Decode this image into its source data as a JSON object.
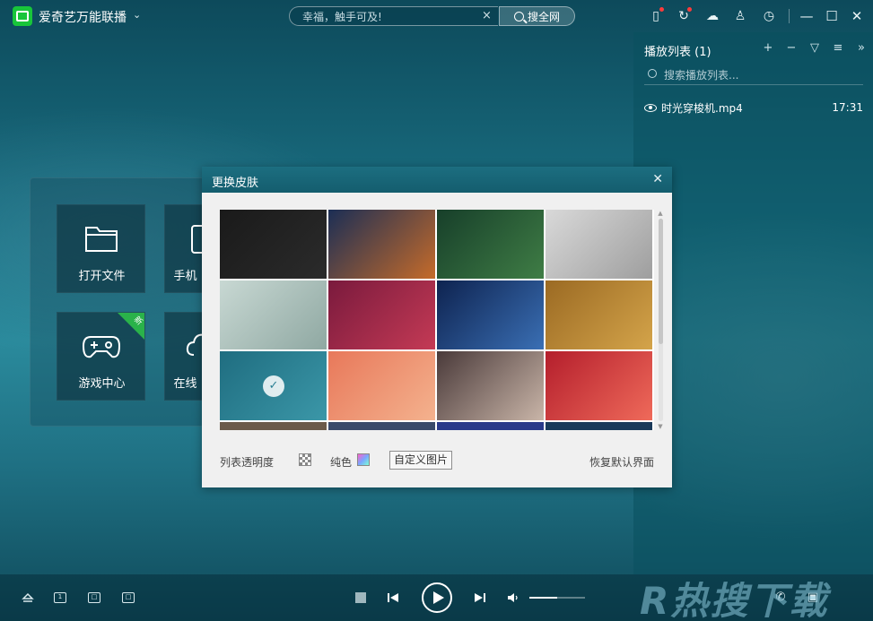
{
  "titlebar": {
    "app_title": "爱奇艺万能联播",
    "search_placeholder": "幸福，触手可及!",
    "search_button": "搜全网"
  },
  "playlist": {
    "title": "播放列表 (1)",
    "search_placeholder": "搜索播放列表...",
    "items": [
      {
        "name": "时光穿梭机.mp4",
        "duration": "17:31"
      }
    ]
  },
  "home": {
    "tiles": [
      {
        "label": "打开文件",
        "icon": "folder-icon"
      },
      {
        "label": "手机",
        "icon": "phone-icon"
      },
      {
        "label": "游戏中心",
        "icon": "gamepad-icon",
        "badge": "新"
      },
      {
        "label": "在线",
        "icon": "cloud-icon"
      }
    ]
  },
  "skin_dialog": {
    "title": "更换皮肤",
    "selected_index": 8,
    "skins": [
      {
        "name": "skin-iqiyi-logo",
        "colors": [
          "#1a1a1a",
          "#2b2b2b"
        ]
      },
      {
        "name": "skin-cartoon-rabbit",
        "colors": [
          "#1b2e55",
          "#c56b2a"
        ]
      },
      {
        "name": "skin-lotus",
        "colors": [
          "#173f2a",
          "#3f7d45"
        ]
      },
      {
        "name": "skin-gray-geometry",
        "colors": [
          "#d9d9d9",
          "#9e9e9e"
        ]
      },
      {
        "name": "skin-umbrella",
        "colors": [
          "#c8d8d3",
          "#8fa8a2"
        ]
      },
      {
        "name": "skin-red-fabric",
        "colors": [
          "#7a1a3d",
          "#c43a55"
        ]
      },
      {
        "name": "skin-starry-night",
        "colors": [
          "#0e2350",
          "#3a6fb4"
        ]
      },
      {
        "name": "skin-wheat-field",
        "colors": [
          "#9b6a23",
          "#d4a44a"
        ]
      },
      {
        "name": "skin-water-drops",
        "colors": [
          "#1f6d80",
          "#3b97a8"
        ]
      },
      {
        "name": "skin-peach-clouds",
        "colors": [
          "#e8785a",
          "#f4b28e"
        ]
      },
      {
        "name": "skin-leaf-macro",
        "colors": [
          "#4a3a3a",
          "#c9b5a8"
        ]
      },
      {
        "name": "skin-red-drop",
        "colors": [
          "#b41e2c",
          "#ef6a5a"
        ]
      }
    ],
    "footer": {
      "transparency_label": "列表透明度",
      "solid_label": "纯色",
      "custom_button": "自定义图片",
      "restore_link": "恢复默认界面"
    }
  },
  "controls": {
    "volume_level": 0.5
  },
  "watermark": "R热搜下载"
}
